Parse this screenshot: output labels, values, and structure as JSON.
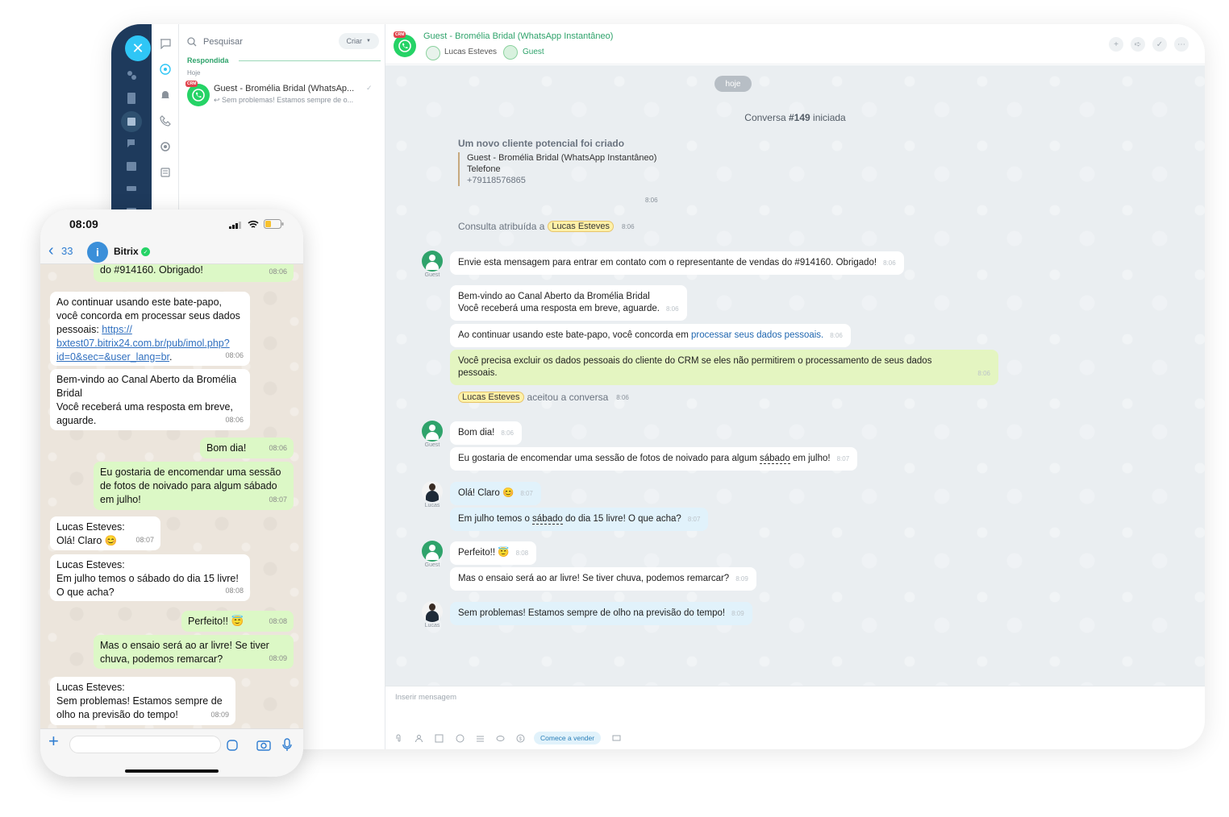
{
  "desktop": {
    "sidebar": {
      "close_icon": "close-icon",
      "dark_icons": [
        "users-icon",
        "document-icon",
        "calendar-box-icon",
        "chat-icon",
        "calendar-icon",
        "drive-icon",
        "mail-icon"
      ],
      "light_icons": [
        "chat-bubble-icon",
        "openlines-icon",
        "bell-icon",
        "phone-icon",
        "settings-icon",
        "tasks-icon"
      ]
    },
    "list": {
      "search_placeholder": "Pesquisar",
      "create_label": "Criar",
      "section": "Respondida",
      "day": "Hoje",
      "item_title": "Guest - Bromélia Bridal (WhatsAp...",
      "item_preview": "Sem problemas! Estamos sempre de o...",
      "crm_badge": "CRM"
    },
    "header": {
      "title": "Guest - Bromélia Bridal (WhatsApp Instantâneo)",
      "user1": "Lucas Esteves",
      "user2": "Guest"
    },
    "chat": {
      "date_pill": "hoje",
      "conversation_prefix": "Conversa ",
      "conversation_number": "#149",
      "conversation_suffix": " iniciada",
      "lead_title": "Um novo cliente potencial foi criado",
      "lead_name": "Guest - Bromélia Bridal (WhatsApp Instantâneo)",
      "lead_phone_label": "Telefone",
      "lead_phone": "+79118576865",
      "lead_time": "8:06",
      "assigned_text": "Consulta atribuída a",
      "assigned_to": "Lucas Esteves",
      "assigned_time": "8:06",
      "accepted_by": "Lucas Esteves",
      "accepted_text": "aceitou a conversa",
      "accepted_time": "8:06",
      "guest_label": "Guest",
      "lucas_label": "Lucas",
      "messages": [
        {
          "text": "Envie esta mensagem para entrar em contato com o representante de vendas do #914160. Obrigado!",
          "time": "8:06"
        },
        {
          "line1": "Bem-vindo ao Canal Aberto da Bromélia Bridal",
          "line2": "Você receberá uma resposta em breve, aguarde.",
          "time": "8:06"
        },
        {
          "text": "Ao continuar usando este bate-papo, você concorda em ",
          "link": "processar seus dados pessoais.",
          "time": "8:06"
        },
        {
          "line1": "Você precisa excluir os dados pessoais do cliente do CRM se eles não permitirem o processamento de seus dados",
          "line2": "pessoais.",
          "time": "8:06"
        },
        {
          "text": "Bom dia!",
          "time": "8:06"
        },
        {
          "pre": "Eu gostaria de encomendar uma sessão de fotos de noivado para algum ",
          "underlined": "sábado",
          "post": " em julho!",
          "time": "8:07"
        },
        {
          "text": "Olá! Claro",
          "emoji": "😊",
          "time": "8:07"
        },
        {
          "pre": "Em julho temos o ",
          "underlined": "sábado",
          "post": " do dia 15 livre! O que acha?",
          "time": "8:07"
        },
        {
          "text": "Perfeito!!",
          "emoji": "😇",
          "time": "8:08"
        },
        {
          "text": "Mas o ensaio será ao ar livre! Se tiver chuva, podemos remarcar?",
          "time": "8:09"
        },
        {
          "text": "Sem problemas! Estamos sempre de olho na previsão do tempo!",
          "time": "8:09"
        }
      ]
    },
    "input": {
      "placeholder": "Inserir mensagem",
      "sell_button": "Comece a vender",
      "tools": [
        "attach-icon",
        "user-icon",
        "template-icon",
        "emoji-icon",
        "list-icon",
        "eraser-icon",
        "payment-icon",
        "screen-icon"
      ]
    }
  },
  "phone": {
    "time": "08:09",
    "back_count": "33",
    "contact": "Bitrix",
    "avatar_letter": "i",
    "messages": [
      {
        "text": "do #914160. Obrigado!",
        "time": "08:06"
      },
      {
        "text": "Ao continuar usando este bate-papo, você concorda em processar seus dados pessoais: ",
        "link": "https://bxtest07.bitrix24.com.br/pub/imol.php?id=0&sec=&user_lang=br",
        "link_display_1": "https://",
        "link_display_2": "bxtest07.bitrix24.com.br/pub/imol.php?",
        "link_display_3": "id=0&sec=&user_lang=br",
        "suffix": ".",
        "time": "08:06"
      },
      {
        "line1": "Bem-vindo ao Canal Aberto da Bromélia",
        "line2": "Bridal",
        "line3": "Você receberá uma resposta em breve,",
        "line4": "aguarde.",
        "time": "08:06"
      },
      {
        "text": "Bom dia!",
        "time": "08:06"
      },
      {
        "line1": "Eu gostaria de encomendar uma sessão",
        "line2": "de fotos de noivado para algum sábado",
        "line3": "em julho!",
        "time": "08:07"
      },
      {
        "line1": "Lucas Esteves:",
        "line2": "Olá! Claro",
        "emoji": "😊",
        "time": "08:07"
      },
      {
        "line1": "Lucas Esteves:",
        "line2": "Em julho temos o sábado do dia 15 livre!",
        "line3": "O que acha?",
        "time": "08:08"
      },
      {
        "text": "Perfeito!!",
        "emoji": "😇",
        "time": "08:08"
      },
      {
        "line1": "Mas o ensaio será ao ar livre! Se tiver",
        "line2": "chuva, podemos remarcar?",
        "time": "08:09"
      },
      {
        "line1": "Lucas Esteves:",
        "line2": "Sem problemas! Estamos sempre de",
        "line3": "olho na previsão do tempo!",
        "time": "08:09"
      }
    ]
  }
}
